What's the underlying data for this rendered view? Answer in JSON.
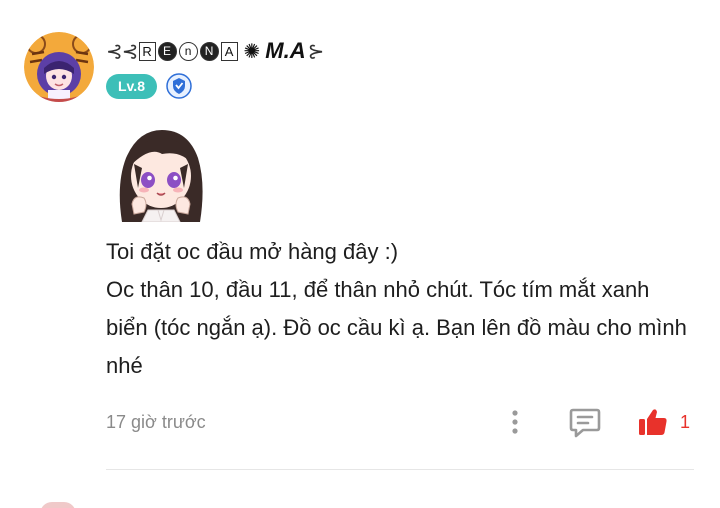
{
  "comment": {
    "user": {
      "name_prefix_deco": "⊰",
      "name_tags": [
        "R",
        "E",
        "n",
        "N",
        "A"
      ],
      "name_sun": "✺",
      "name_text": "M.A",
      "name_suffix_deco": "⊱",
      "level": "Lv.8",
      "verify_icon": "verified-shield-icon"
    },
    "text": "Toi đặt oc đầu mở hàng đây :)\nOc thân 10, đầu 11, để thân nhỏ chút. Tóc tím mắt xanh biển (tóc ngắn ạ). Đồ oc cầu kì ạ. Bạn lên đồ màu cho mình nhé",
    "timestamp": "17 giờ trước",
    "likes": "1",
    "colors": {
      "level_badge": "#3dbfb8",
      "like": "#e8322b",
      "timestamp": "#8a8a8a"
    }
  }
}
